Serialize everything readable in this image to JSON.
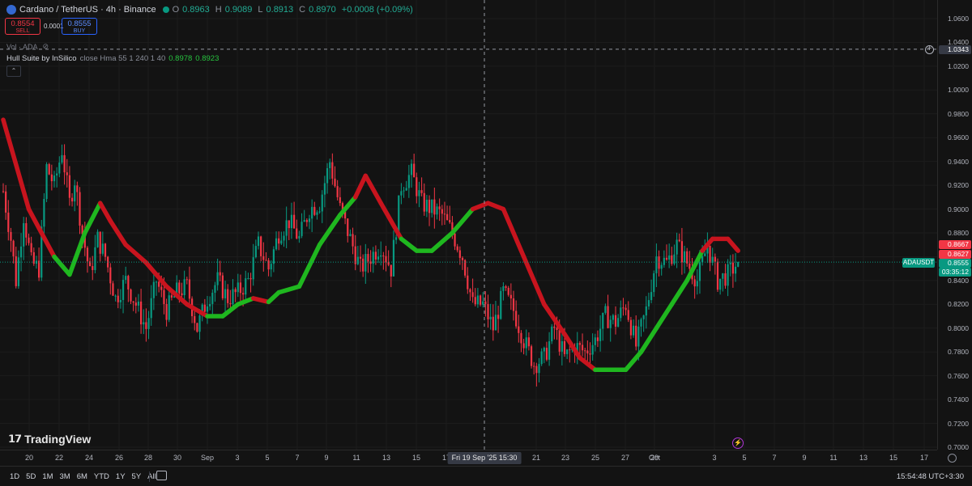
{
  "header": {
    "symbol_title": "Cardano / TetherUS · 4h · Binance",
    "ohlc": [
      {
        "key": "O",
        "value": "0.8963"
      },
      {
        "key": "H",
        "value": "0.9089"
      },
      {
        "key": "L",
        "value": "0.8913"
      },
      {
        "key": "C",
        "value": "0.8970"
      }
    ],
    "change": "+0.0008 (+0.09%)"
  },
  "trade": {
    "sell_price": "0.8554",
    "sell_label": "SELL",
    "spread": "0.0001",
    "buy_price": "0.8555",
    "buy_label": "BUY"
  },
  "volume_label": "Vol · ADA",
  "indicator": {
    "name": "Hull Suite by InSilico",
    "params": "close Hma 55 1 240 1 40",
    "value1": "0.8978",
    "value2": "0.8923"
  },
  "logo_text": "TradingView",
  "price_scale": {
    "ticks": [
      "1.0600",
      "1.0400",
      "1.0200",
      "1.0000",
      "0.9800",
      "0.9600",
      "0.9400",
      "0.9200",
      "0.9000",
      "0.8800",
      "0.8600",
      "0.8400",
      "0.8200",
      "0.8000",
      "0.7800",
      "0.7600",
      "0.7400",
      "0.7200",
      "0.7000"
    ],
    "crosshair_price": "1.0343",
    "hull_upper": "0.8667",
    "hull_lower": "0.8627",
    "last_price": "0.8555",
    "countdown": "03:35:12",
    "symbol_tag": "ADAUSDT"
  },
  "time_scale": {
    "ticks": [
      "20",
      "22",
      "24",
      "26",
      "28",
      "30",
      "Sep",
      "3",
      "5",
      "7",
      "9",
      "11",
      "13",
      "15",
      "17",
      "21",
      "23",
      "25",
      "27",
      "29",
      "Oct",
      "3",
      "5",
      "7",
      "9",
      "11",
      "13",
      "15",
      "17",
      "19"
    ],
    "crosshair_time": "Fri 19 Sep '25   15:30"
  },
  "bottom_bar": {
    "timeframes": [
      "1D",
      "5D",
      "1M",
      "3M",
      "6M",
      "YTD",
      "1Y",
      "5Y",
      "All"
    ],
    "clock": "15:54:48 UTC+3:30"
  },
  "colors": {
    "up": "#089981",
    "down": "#f23645",
    "hull_up": "#1fb71f",
    "hull_down": "#c8141e",
    "background": "#131313"
  },
  "chart_data": {
    "type": "candlestick",
    "symbol": "ADAUSDT",
    "interval": "4h",
    "ylim": [
      0.7,
      1.07
    ],
    "x_start": "Aug 19",
    "x_end": "Oct 6",
    "close_path": [
      [
        0,
        0.915
      ],
      [
        3,
        0.875
      ],
      [
        5,
        0.84
      ],
      [
        8,
        0.895
      ],
      [
        11,
        0.855
      ],
      [
        14,
        0.85
      ],
      [
        17,
        0.935
      ],
      [
        20,
        0.92
      ],
      [
        23,
        0.95
      ],
      [
        26,
        0.905
      ],
      [
        28,
        0.925
      ],
      [
        31,
        0.88
      ],
      [
        34,
        0.845
      ],
      [
        37,
        0.875
      ],
      [
        40,
        0.86
      ],
      [
        44,
        0.825
      ],
      [
        48,
        0.84
      ],
      [
        52,
        0.82
      ],
      [
        56,
        0.8
      ],
      [
        60,
        0.84
      ],
      [
        64,
        0.815
      ],
      [
        68,
        0.83
      ],
      [
        72,
        0.835
      ],
      [
        76,
        0.8
      ],
      [
        80,
        0.825
      ],
      [
        84,
        0.84
      ],
      [
        88,
        0.825
      ],
      [
        92,
        0.83
      ],
      [
        96,
        0.84
      ],
      [
        100,
        0.87
      ],
      [
        104,
        0.85
      ],
      [
        108,
        0.88
      ],
      [
        112,
        0.89
      ],
      [
        116,
        0.875
      ],
      [
        120,
        0.9
      ],
      [
        124,
        0.905
      ],
      [
        128,
        0.94
      ],
      [
        132,
        0.9
      ],
      [
        136,
        0.875
      ],
      [
        140,
        0.85
      ],
      [
        144,
        0.86
      ],
      [
        148,
        0.87
      ],
      [
        152,
        0.85
      ],
      [
        156,
        0.92
      ],
      [
        160,
        0.93
      ],
      [
        164,
        0.905
      ],
      [
        168,
        0.9
      ],
      [
        172,
        0.895
      ],
      [
        176,
        0.88
      ],
      [
        180,
        0.86
      ],
      [
        184,
        0.82
      ],
      [
        188,
        0.82
      ],
      [
        192,
        0.8
      ],
      [
        196,
        0.83
      ],
      [
        200,
        0.815
      ],
      [
        204,
        0.79
      ],
      [
        208,
        0.77
      ],
      [
        212,
        0.775
      ],
      [
        216,
        0.8
      ],
      [
        220,
        0.775
      ],
      [
        224,
        0.785
      ],
      [
        228,
        0.78
      ],
      [
        232,
        0.79
      ],
      [
        236,
        0.81
      ],
      [
        240,
        0.805
      ],
      [
        244,
        0.82
      ],
      [
        248,
        0.785
      ],
      [
        252,
        0.815
      ],
      [
        256,
        0.86
      ],
      [
        260,
        0.855
      ],
      [
        264,
        0.87
      ],
      [
        268,
        0.855
      ],
      [
        272,
        0.84
      ],
      [
        276,
        0.87
      ],
      [
        280,
        0.84
      ],
      [
        284,
        0.845
      ],
      [
        288,
        0.8555
      ]
    ],
    "hull_suite": [
      [
        0,
        0.975,
        "down"
      ],
      [
        10,
        0.9,
        "down"
      ],
      [
        20,
        0.86,
        "down"
      ],
      [
        26,
        0.845,
        "up"
      ],
      [
        32,
        0.88,
        "up"
      ],
      [
        38,
        0.905,
        "up"
      ],
      [
        42,
        0.89,
        "down"
      ],
      [
        48,
        0.87,
        "down"
      ],
      [
        56,
        0.855,
        "down"
      ],
      [
        64,
        0.835,
        "down"
      ],
      [
        72,
        0.82,
        "down"
      ],
      [
        80,
        0.81,
        "down"
      ],
      [
        86,
        0.81,
        "up"
      ],
      [
        92,
        0.82,
        "up"
      ],
      [
        98,
        0.825,
        "up"
      ],
      [
        104,
        0.822,
        "down"
      ],
      [
        108,
        0.83,
        "up"
      ],
      [
        116,
        0.835,
        "up"
      ],
      [
        124,
        0.87,
        "up"
      ],
      [
        132,
        0.895,
        "up"
      ],
      [
        138,
        0.91,
        "up"
      ],
      [
        142,
        0.928,
        "down"
      ],
      [
        148,
        0.905,
        "down"
      ],
      [
        156,
        0.875,
        "down"
      ],
      [
        162,
        0.865,
        "up"
      ],
      [
        168,
        0.865,
        "up"
      ],
      [
        176,
        0.88,
        "up"
      ],
      [
        184,
        0.9,
        "up"
      ],
      [
        190,
        0.905,
        "down"
      ],
      [
        196,
        0.9,
        "down"
      ],
      [
        204,
        0.86,
        "down"
      ],
      [
        212,
        0.82,
        "down"
      ],
      [
        220,
        0.795,
        "down"
      ],
      [
        226,
        0.775,
        "down"
      ],
      [
        232,
        0.765,
        "down"
      ],
      [
        238,
        0.765,
        "up"
      ],
      [
        244,
        0.765,
        "up"
      ],
      [
        250,
        0.78,
        "up"
      ],
      [
        256,
        0.8,
        "up"
      ],
      [
        262,
        0.82,
        "up"
      ],
      [
        268,
        0.84,
        "up"
      ],
      [
        274,
        0.865,
        "up"
      ],
      [
        278,
        0.875,
        "down"
      ],
      [
        284,
        0.875,
        "down"
      ],
      [
        288,
        0.865,
        "down"
      ]
    ]
  }
}
